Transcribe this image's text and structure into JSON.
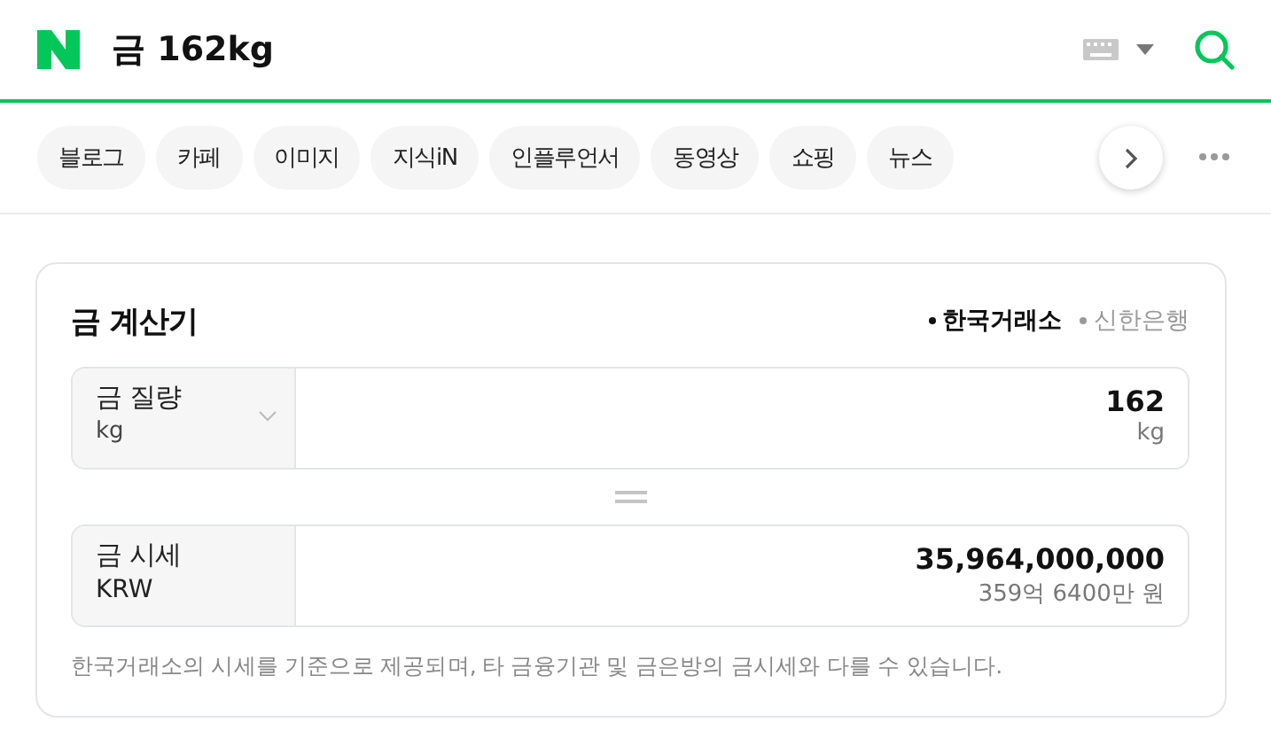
{
  "search": {
    "query": "금 162kg"
  },
  "tabs": [
    {
      "label": "블로그"
    },
    {
      "label": "카페"
    },
    {
      "label": "이미지"
    },
    {
      "label": "지식iN"
    },
    {
      "label": "인플루언서"
    },
    {
      "label": "동영상"
    },
    {
      "label": "쇼핑"
    },
    {
      "label": "뉴스"
    }
  ],
  "calculator": {
    "title": "금 계산기",
    "sources": [
      {
        "label": "한국거래소",
        "selected": true
      },
      {
        "label": "신한은행",
        "selected": false
      }
    ],
    "rows": [
      {
        "label": "금 질량",
        "unit": "kg",
        "value": "162",
        "value_unit": "kg",
        "kind": "input"
      },
      {
        "label": "금 시세",
        "unit": "KRW",
        "value": "35,964,000,000",
        "value_unit": "359억 6400만 원",
        "kind": "result"
      }
    ],
    "note": "한국거래소의 시세를 기준으로 제공되며, 타 금융기관 및 금은방의 금시세와 다를 수 있습니다."
  }
}
